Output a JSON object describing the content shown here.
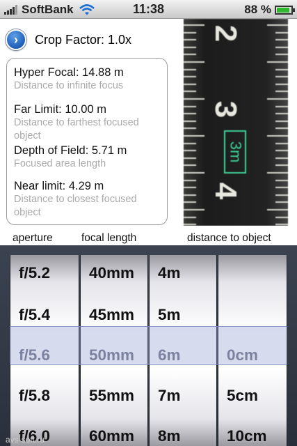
{
  "status_bar": {
    "carrier": "SoftBank",
    "time": "11:38",
    "battery": "88 %",
    "battery_level": 0.88
  },
  "crop_factor": {
    "label": "Crop Factor: 1.0x",
    "button_icon": "chevron-right-icon"
  },
  "info": {
    "hyper_focal": {
      "value": "Hyper Focal: 14.88 m",
      "desc": "Distance to infinite focus"
    },
    "far_limit": {
      "value": "Far Limit: 10.00 m",
      "desc": "Distance to farthest focused object"
    },
    "depth_of_field": {
      "value": "Depth of Field: 5.71 m",
      "desc": "Focused area length"
    },
    "near_limit": {
      "value": "Near limit: 4.29 m",
      "desc": "Distance to closest focused object"
    }
  },
  "photo": {
    "numbers": [
      "2",
      "3",
      "4"
    ],
    "tag": "3m"
  },
  "columns": {
    "aperture": "aperture",
    "focal_length": "focal length",
    "distance": "distance to object"
  },
  "picker": {
    "aperture": [
      "f/5.2",
      "f/5.4",
      "f/5.6",
      "f/5.8",
      "f/6.0"
    ],
    "focal": [
      "40mm",
      "45mm",
      "50mm",
      "55mm",
      "60mm"
    ],
    "distance_m": [
      "4m",
      "5m",
      "6m",
      "7m",
      "8m"
    ],
    "distance_cm": [
      "",
      "",
      "0cm",
      "5cm",
      "10cm"
    ],
    "selected_index": 2
  },
  "watermark": "avs-soft.ru"
}
